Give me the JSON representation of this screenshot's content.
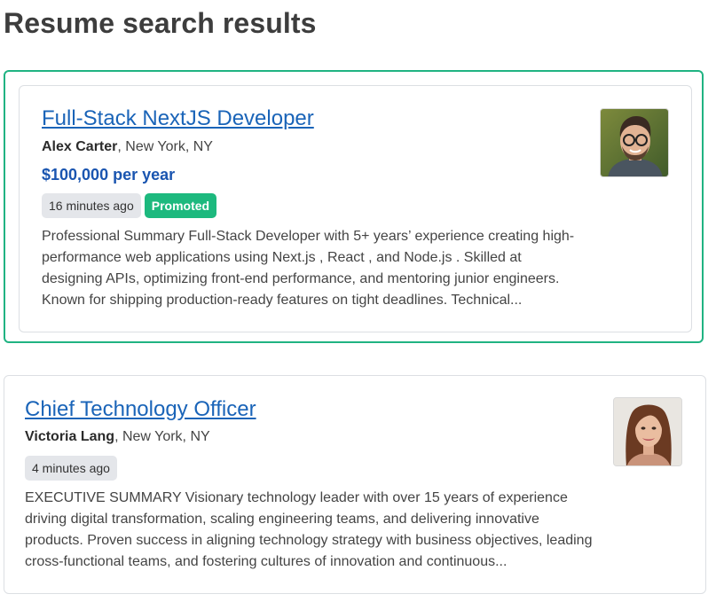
{
  "page": {
    "title": "Resume search results"
  },
  "results": [
    {
      "title": "Full-Stack NextJS Developer",
      "name": "Alex Carter",
      "location": ", New York, NY",
      "salary": "$100,000 per year",
      "posted": "16 minutes ago",
      "promoted_label": "Promoted",
      "summary": "Professional Summary Full-Stack Developer with 5+ years’ experience creating high-performance web applications using Next.js , React , and Node.js . Skilled at designing APIs, optimizing front-end performance, and mentoring junior engineers. Known for shipping production-ready features on tight deadlines. Technical...",
      "avatar_icon": "man-portrait-photo"
    },
    {
      "title": "Chief Technology Officer",
      "name": "Victoria Lang",
      "location": ", New York, NY",
      "posted": "4 minutes ago",
      "summary": "EXECUTIVE SUMMARY Visionary technology leader with over 15 years of experience driving digital transformation, scaling engineering teams, and delivering innovative products. Proven success in aligning technology strategy with business objectives, leading cross-functional teams, and fostering cultures of innovation and continuous...",
      "avatar_icon": "woman-portrait-photo"
    }
  ],
  "colors": {
    "promoted_border": "#20b382",
    "promoted_badge": "#1db97e",
    "link": "#1a64b8",
    "salary": "#1a55b0"
  }
}
